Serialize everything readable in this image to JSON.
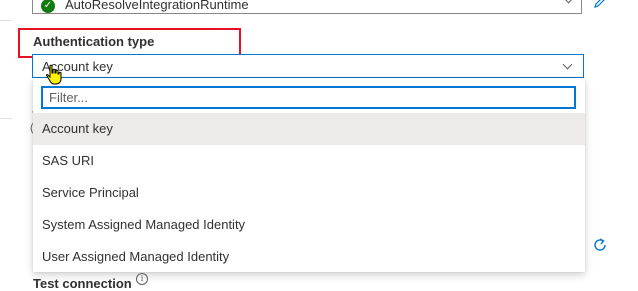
{
  "integration_runtime": {
    "value": "AutoResolveIntegrationRuntime",
    "status_icon": "check-circle-icon",
    "status_color": "#107c10"
  },
  "authentication": {
    "label": "Authentication type",
    "selected_value": "Account key",
    "filter_placeholder": "Filter...",
    "options": [
      "Account key",
      "SAS URI",
      "Service Principal",
      "System Assigned Managed Identity",
      "User Assigned Managed Identity"
    ]
  },
  "test_connection": {
    "label": "Test connection",
    "info_icon": "info-icon"
  },
  "colors": {
    "accent": "#0078d4",
    "highlight_border": "#e81123",
    "selected_option_bg": "#edebe9"
  }
}
